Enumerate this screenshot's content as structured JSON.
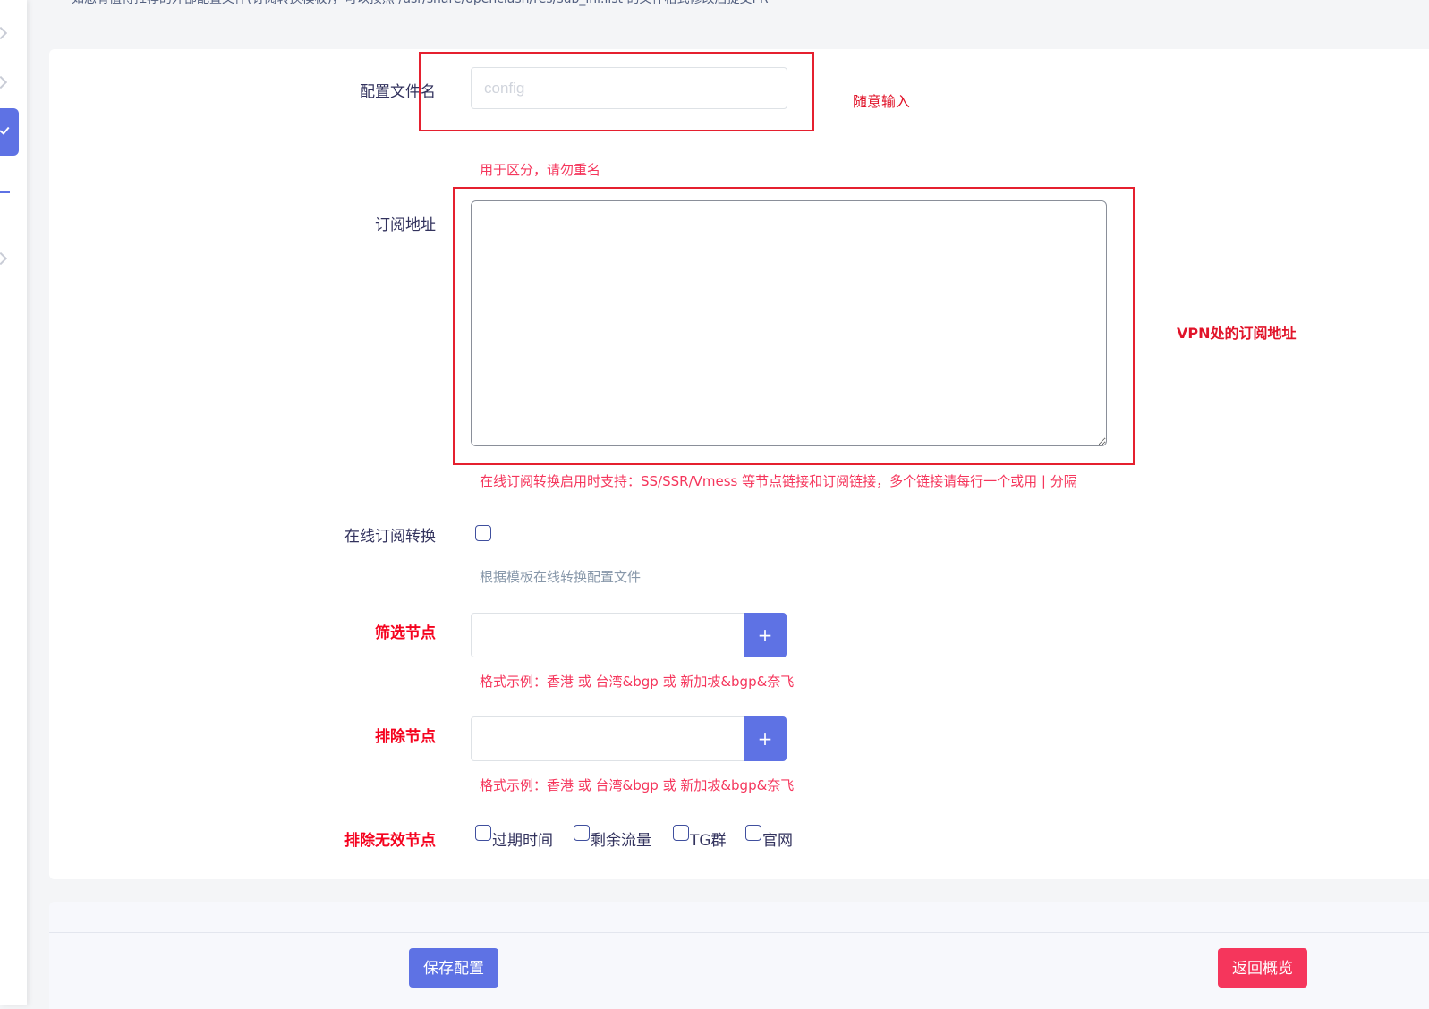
{
  "top_note": "如您有值得推荐的外部配置文件(订阅转换模板)，可以按照 /usr/share/openclash/res/sub_ini.list 的文件格式修改后提交PR",
  "form": {
    "config_name": {
      "label": "配置文件名",
      "placeholder": "config",
      "value": "",
      "hint": "用于区分，请勿重名"
    },
    "subscribe_url": {
      "label": "订阅地址",
      "value": "",
      "hint": "在线订阅转换启用时支持：SS/SSR/Vmess 等节点链接和订阅链接，多个链接请每行一个或用 | 分隔"
    },
    "online_convert": {
      "label": "在线订阅转换",
      "checked": false,
      "hint": "根据模板在线转换配置文件"
    },
    "filter_nodes": {
      "label": "筛选节点",
      "value": "",
      "add_label": "+",
      "hint": "格式示例：香港 或 台湾&bgp 或 新加坡&bgp&奈飞"
    },
    "exclude_nodes": {
      "label": "排除节点",
      "value": "",
      "add_label": "+",
      "hint": "格式示例：香港 或 台湾&bgp 或 新加坡&bgp&奈飞"
    },
    "exclude_invalid": {
      "label": "排除无效节点",
      "options": [
        {
          "label": "过期时间",
          "checked": false
        },
        {
          "label": "剩余流量",
          "checked": false
        },
        {
          "label": "TG群",
          "checked": false
        },
        {
          "label": "官网",
          "checked": false
        }
      ]
    }
  },
  "annotations": {
    "config_name": "随意输入",
    "subscribe_url": "VPN处的订阅地址"
  },
  "actions": {
    "save": "保存配置",
    "back": "返回概览"
  },
  "colors": {
    "primary": "#5e72e4",
    "danger": "#f5365c",
    "annotation": "#e5202f"
  }
}
